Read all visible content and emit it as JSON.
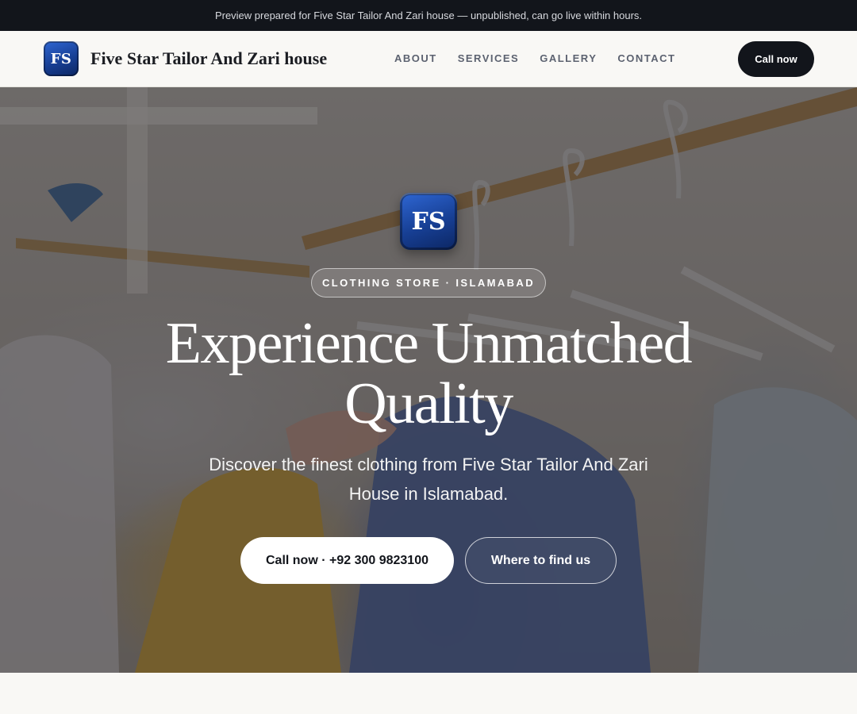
{
  "preview_bar": {
    "text": "Preview prepared for Five Star Tailor And Zari house — unpublished, can go live within hours."
  },
  "header": {
    "logo_text": "FS",
    "brand_name": "Five Star Tailor And Zari house",
    "nav": [
      "ABOUT",
      "SERVICES",
      "GALLERY",
      "CONTACT"
    ],
    "call_button": "Call now"
  },
  "hero": {
    "logo_text": "FS",
    "tag": "CLOTHING STORE · ISLAMABAD",
    "title": "Experience Unmatched Quality",
    "subtitle": "Discover the finest clothing from Five Star Tailor And Zari House in Islamabad.",
    "primary_button": "Call now · +92 300 9823100",
    "secondary_button": "Where to find us",
    "background_description_icon": "clothing-rack-photo"
  },
  "colors": {
    "dark": "#12151b",
    "page_bg": "#f9f8f5",
    "logo_blue": "#173f94",
    "nav_text": "#5c6270"
  }
}
